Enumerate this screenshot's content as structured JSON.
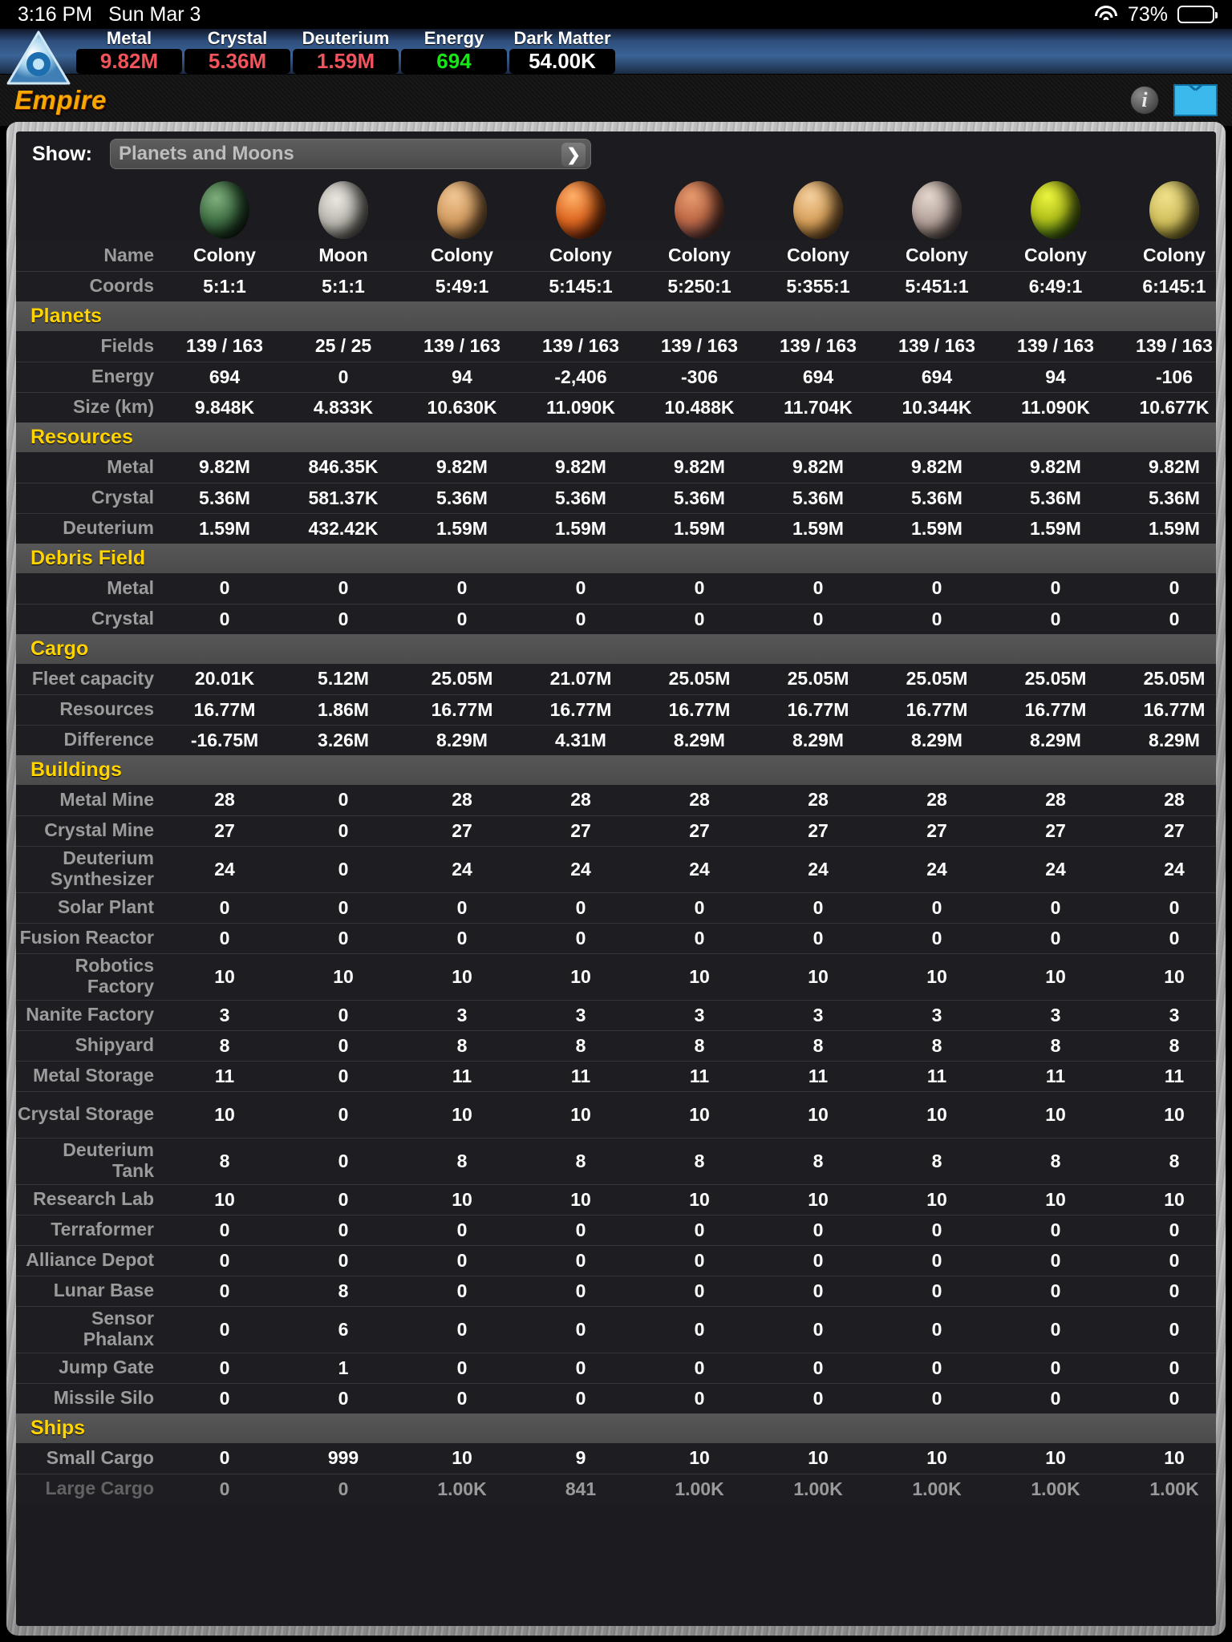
{
  "status_bar": {
    "time": "3:16 PM",
    "date": "Sun Mar 3",
    "battery_percent": "73%",
    "wifi_icon": "wifi-icon",
    "battery_icon": "battery-icon"
  },
  "resource_bar": {
    "logo_icon": "game-logo-icon",
    "items": [
      {
        "label": "Metal",
        "value": "9.82M",
        "color": "#f1545c"
      },
      {
        "label": "Crystal",
        "value": "5.36M",
        "color": "#f1545c"
      },
      {
        "label": "Deuterium",
        "value": "1.59M",
        "color": "#f1545c"
      },
      {
        "label": "Energy",
        "value": "694",
        "color": "#19e619"
      },
      {
        "label": "Dark Matter",
        "value": "54.00K",
        "color": "#ffffff"
      }
    ]
  },
  "header": {
    "title": "Empire",
    "info_icon": "info-icon",
    "mail_icon": "mail-envelope-icon"
  },
  "show": {
    "label": "Show:",
    "selected": "Planets and Moons",
    "chevron_icon": "chevron-right-icon"
  },
  "table": {
    "columns": [
      {
        "icon": "planet-icon-green",
        "class": "p-green",
        "name": "Colony",
        "coords": "5:1:1"
      },
      {
        "icon": "moon-icon",
        "class": "p-moon",
        "name": "Moon",
        "coords": "5:1:1"
      },
      {
        "icon": "planet-icon-desert",
        "class": "p-desert",
        "name": "Colony",
        "coords": "5:49:1"
      },
      {
        "icon": "planet-icon-jupiter",
        "class": "p-jupiter",
        "name": "Colony",
        "coords": "5:145:1"
      },
      {
        "icon": "planet-icon-mars",
        "class": "p-mars",
        "name": "Colony",
        "coords": "5:250:1"
      },
      {
        "icon": "planet-icon-sand",
        "class": "p-sand",
        "name": "Colony",
        "coords": "5:355:1"
      },
      {
        "icon": "planet-icon-grey",
        "class": "p-grey",
        "name": "Colony",
        "coords": "5:451:1"
      },
      {
        "icon": "planet-icon-yellow",
        "class": "p-yellow",
        "name": "Colony",
        "coords": "6:49:1"
      },
      {
        "icon": "planet-icon-gold",
        "class": "p-gold",
        "name": "Colony",
        "coords": "6:145:1"
      }
    ],
    "header_rows": [
      {
        "label": "Name",
        "values": [
          "Colony",
          "Moon",
          "Colony",
          "Colony",
          "Colony",
          "Colony",
          "Colony",
          "Colony",
          "Colony"
        ]
      },
      {
        "label": "Coords",
        "values": [
          "5:1:1",
          "5:1:1",
          "5:49:1",
          "5:145:1",
          "5:250:1",
          "5:355:1",
          "5:451:1",
          "6:49:1",
          "6:145:1"
        ]
      }
    ],
    "sections": [
      {
        "title": "Planets",
        "rows": [
          {
            "label": "Fields",
            "values": [
              "139 / 163",
              "25 / 25",
              "139 / 163",
              "139 / 163",
              "139 / 163",
              "139 / 163",
              "139 / 163",
              "139 / 163",
              "139 / 163"
            ],
            "colors": [
              "w",
              "w",
              "w",
              "w",
              "w",
              "w",
              "w",
              "w",
              "w"
            ]
          },
          {
            "label": "Energy",
            "values": [
              "694",
              "0",
              "94",
              "-2,406",
              "-306",
              "694",
              "694",
              "94",
              "-106"
            ],
            "colors": [
              "g",
              "w",
              "g",
              "r",
              "r",
              "g",
              "g",
              "g",
              "r"
            ]
          },
          {
            "label": "Size (km)",
            "values": [
              "9.848K",
              "4.833K",
              "10.630K",
              "11.090K",
              "10.488K",
              "11.704K",
              "10.344K",
              "11.090K",
              "10.677K"
            ],
            "colors": [
              "w",
              "w",
              "w",
              "w",
              "w",
              "w",
              "w",
              "w",
              "w"
            ]
          }
        ]
      },
      {
        "title": "Resources",
        "rows": [
          {
            "label": "Metal",
            "values": [
              "9.82M",
              "846.35K",
              "9.82M",
              "9.82M",
              "9.82M",
              "9.82M",
              "9.82M",
              "9.82M",
              "9.82M"
            ],
            "colors": [
              "r",
              "r",
              "r",
              "r",
              "r",
              "r",
              "r",
              "r",
              "r"
            ]
          },
          {
            "label": "Crystal",
            "values": [
              "5.36M",
              "581.37K",
              "5.36M",
              "5.36M",
              "5.36M",
              "5.36M",
              "5.36M",
              "5.36M",
              "5.36M"
            ],
            "colors": [
              "r",
              "r",
              "r",
              "r",
              "r",
              "r",
              "r",
              "r",
              "r"
            ]
          },
          {
            "label": "Deuterium",
            "values": [
              "1.59M",
              "432.42K",
              "1.59M",
              "1.59M",
              "1.59M",
              "1.59M",
              "1.59M",
              "1.59M",
              "1.59M"
            ],
            "colors": [
              "r",
              "r",
              "r",
              "r",
              "r",
              "r",
              "r",
              "r",
              "r"
            ]
          }
        ]
      },
      {
        "title": "Debris Field",
        "rows": [
          {
            "label": "Metal",
            "values": [
              "0",
              "0",
              "0",
              "0",
              "0",
              "0",
              "0",
              "0",
              "0"
            ],
            "colors": [
              "w",
              "w",
              "w",
              "w",
              "w",
              "w",
              "w",
              "w",
              "w"
            ]
          },
          {
            "label": "Crystal",
            "values": [
              "0",
              "0",
              "0",
              "0",
              "0",
              "0",
              "0",
              "0",
              "0"
            ],
            "colors": [
              "w",
              "w",
              "w",
              "w",
              "w",
              "w",
              "w",
              "w",
              "w"
            ]
          }
        ]
      },
      {
        "title": "Cargo",
        "rows": [
          {
            "label": "Fleet capacity",
            "values": [
              "20.01K",
              "5.12M",
              "25.05M",
              "21.07M",
              "25.05M",
              "25.05M",
              "25.05M",
              "25.05M",
              "25.05M"
            ],
            "colors": [
              "w",
              "w",
              "w",
              "w",
              "w",
              "w",
              "w",
              "w",
              "w"
            ]
          },
          {
            "label": "Resources",
            "values": [
              "16.77M",
              "1.86M",
              "16.77M",
              "16.77M",
              "16.77M",
              "16.77M",
              "16.77M",
              "16.77M",
              "16.77M"
            ],
            "colors": [
              "w",
              "w",
              "w",
              "w",
              "w",
              "w",
              "w",
              "w",
              "w"
            ]
          },
          {
            "label": "Difference",
            "values": [
              "-16.75M",
              "3.26M",
              "8.29M",
              "4.31M",
              "8.29M",
              "8.29M",
              "8.29M",
              "8.29M",
              "8.29M"
            ],
            "colors": [
              "r",
              "g",
              "g",
              "g",
              "g",
              "g",
              "g",
              "g",
              "g"
            ]
          }
        ]
      },
      {
        "title": "Buildings",
        "rows": [
          {
            "label": "Metal Mine",
            "values": [
              "28",
              "0",
              "28",
              "28",
              "28",
              "28",
              "28",
              "28",
              "28"
            ],
            "colors": [
              "w",
              "w",
              "w",
              "w",
              "w",
              "w",
              "w",
              "w",
              "w"
            ]
          },
          {
            "label": "Crystal Mine",
            "values": [
              "27",
              "0",
              "27",
              "27",
              "27",
              "27",
              "27",
              "27",
              "27"
            ],
            "colors": [
              "w",
              "w",
              "w",
              "w",
              "w",
              "w",
              "w",
              "w",
              "w"
            ]
          },
          {
            "label": "Deuterium Synthesizer",
            "values": [
              "24",
              "0",
              "24",
              "24",
              "24",
              "24",
              "24",
              "24",
              "24"
            ],
            "colors": [
              "w",
              "w",
              "w",
              "w",
              "w",
              "w",
              "w",
              "w",
              "w"
            ],
            "tall": true
          },
          {
            "label": "Solar Plant",
            "values": [
              "0",
              "0",
              "0",
              "0",
              "0",
              "0",
              "0",
              "0",
              "0"
            ],
            "colors": [
              "w",
              "w",
              "w",
              "w",
              "w",
              "w",
              "w",
              "w",
              "w"
            ]
          },
          {
            "label": "Fusion Reactor",
            "values": [
              "0",
              "0",
              "0",
              "0",
              "0",
              "0",
              "0",
              "0",
              "0"
            ],
            "colors": [
              "w",
              "w",
              "w",
              "w",
              "w",
              "w",
              "w",
              "w",
              "w"
            ]
          },
          {
            "label": "Robotics Factory",
            "values": [
              "10",
              "10",
              "10",
              "10",
              "10",
              "10",
              "10",
              "10",
              "10"
            ],
            "colors": [
              "w",
              "w",
              "w",
              "w",
              "w",
              "w",
              "w",
              "w",
              "w"
            ],
            "tall": true
          },
          {
            "label": "Nanite Factory",
            "values": [
              "3",
              "0",
              "3",
              "3",
              "3",
              "3",
              "3",
              "3",
              "3"
            ],
            "colors": [
              "w",
              "w",
              "w",
              "w",
              "w",
              "w",
              "w",
              "w",
              "w"
            ]
          },
          {
            "label": "Shipyard",
            "values": [
              "8",
              "0",
              "8",
              "8",
              "8",
              "8",
              "8",
              "8",
              "8"
            ],
            "colors": [
              "w",
              "w",
              "w",
              "w",
              "w",
              "w",
              "w",
              "w",
              "w"
            ]
          },
          {
            "label": "Metal Storage",
            "values": [
              "11",
              "0",
              "11",
              "11",
              "11",
              "11",
              "11",
              "11",
              "11"
            ],
            "colors": [
              "w",
              "w",
              "w",
              "w",
              "w",
              "w",
              "w",
              "w",
              "w"
            ]
          },
          {
            "label": "Crystal Storage",
            "values": [
              "10",
              "0",
              "10",
              "10",
              "10",
              "10",
              "10",
              "10",
              "10"
            ],
            "colors": [
              "w",
              "w",
              "w",
              "w",
              "w",
              "w",
              "w",
              "w",
              "w"
            ],
            "tall": true
          },
          {
            "label": "Deuterium Tank",
            "values": [
              "8",
              "0",
              "8",
              "8",
              "8",
              "8",
              "8",
              "8",
              "8"
            ],
            "colors": [
              "w",
              "w",
              "w",
              "w",
              "w",
              "w",
              "w",
              "w",
              "w"
            ],
            "tall": true
          },
          {
            "label": "Research Lab",
            "values": [
              "10",
              "0",
              "10",
              "10",
              "10",
              "10",
              "10",
              "10",
              "10"
            ],
            "colors": [
              "w",
              "w",
              "w",
              "w",
              "w",
              "w",
              "w",
              "w",
              "w"
            ]
          },
          {
            "label": "Terraformer",
            "values": [
              "0",
              "0",
              "0",
              "0",
              "0",
              "0",
              "0",
              "0",
              "0"
            ],
            "colors": [
              "w",
              "w",
              "w",
              "w",
              "w",
              "w",
              "w",
              "w",
              "w"
            ]
          },
          {
            "label": "Alliance Depot",
            "values": [
              "0",
              "0",
              "0",
              "0",
              "0",
              "0",
              "0",
              "0",
              "0"
            ],
            "colors": [
              "w",
              "w",
              "w",
              "w",
              "w",
              "w",
              "w",
              "w",
              "w"
            ]
          },
          {
            "label": "Lunar Base",
            "values": [
              "0",
              "8",
              "0",
              "0",
              "0",
              "0",
              "0",
              "0",
              "0"
            ],
            "colors": [
              "w",
              "w",
              "w",
              "w",
              "w",
              "w",
              "w",
              "w",
              "w"
            ]
          },
          {
            "label": "Sensor Phalanx",
            "values": [
              "0",
              "6",
              "0",
              "0",
              "0",
              "0",
              "0",
              "0",
              "0"
            ],
            "colors": [
              "w",
              "w",
              "w",
              "w",
              "w",
              "w",
              "w",
              "w",
              "w"
            ],
            "tall": true
          },
          {
            "label": "Jump Gate",
            "values": [
              "0",
              "1",
              "0",
              "0",
              "0",
              "0",
              "0",
              "0",
              "0"
            ],
            "colors": [
              "w",
              "w",
              "w",
              "w",
              "w",
              "w",
              "w",
              "w",
              "w"
            ]
          },
          {
            "label": "Missile Silo",
            "values": [
              "0",
              "0",
              "0",
              "0",
              "0",
              "0",
              "0",
              "0",
              "0"
            ],
            "colors": [
              "w",
              "w",
              "w",
              "w",
              "w",
              "w",
              "w",
              "w",
              "w"
            ]
          }
        ]
      },
      {
        "title": "Ships",
        "rows": [
          {
            "label": "Small Cargo",
            "values": [
              "0",
              "999",
              "10",
              "9",
              "10",
              "10",
              "10",
              "10",
              "10"
            ],
            "colors": [
              "w",
              "w",
              "w",
              "w",
              "w",
              "w",
              "w",
              "w",
              "w"
            ]
          },
          {
            "label": "Large Cargo",
            "values": [
              "0",
              "0",
              "1.00K",
              "841",
              "1.00K",
              "1.00K",
              "1.00K",
              "1.00K",
              "1.00K"
            ],
            "colors": [
              "w",
              "w",
              "w",
              "w",
              "w",
              "w",
              "w",
              "w",
              "w"
            ],
            "clipped": true
          }
        ]
      }
    ]
  }
}
